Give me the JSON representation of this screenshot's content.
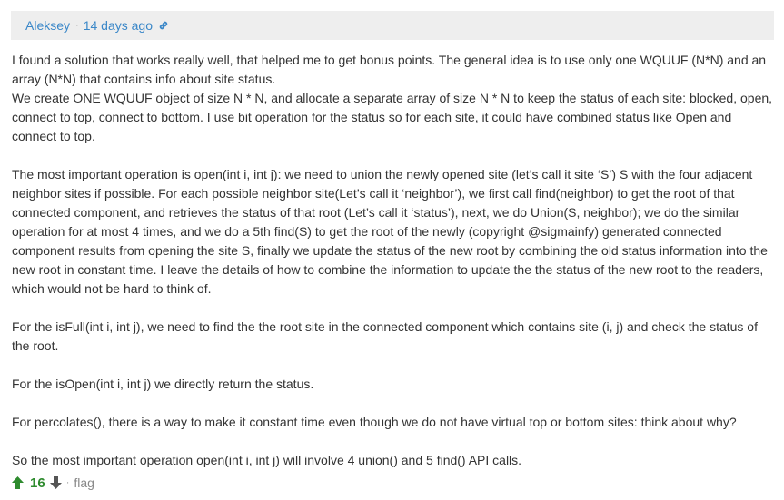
{
  "post": {
    "author": "Aleksey",
    "separator": "·",
    "timestamp": "14 days ago",
    "paragraphs": [
      "I found a solution that works really well, that helped me to get bonus points. The general idea is to use only one WQUUF (N*N) and an array (N*N) that contains info about site status.",
      "We create ONE WQUUF object of size N * N, and allocate a separate array of size N * N to keep the status of each site: blocked, open, connect to top, connect to bottom. I use bit operation for the status so for each site, it could have combined status like Open and connect to top.",
      "The most important operation is open(int i, int j): we need to union the newly opened site (let’s call it site ‘S’) S with the four adjacent neighbor sites if possible. For each possible neighbor site(Let’s call it ‘neighbor’), we first call find(neighbor) to get the root of that connected component, and retrieves the status of that root (Let’s call it ‘status’), next, we do Union(S, neighbor); we do the similar operation for at most 4 times, and we do a 5th find(S) to get the root of the newly (copyright @sigmainfy) generated connected component results from opening the site S, finally we update the status of the new root by combining the old status information into the new root in constant time. I leave the details of how to combine the information to update the the status of the new root to the readers, which would not be hard to think of.",
      "For the isFull(int i, int j), we need to find the the root site in the connected component which contains site (i, j) and check the status of the root.",
      "For the isOpen(int i, int j) we directly return the status.",
      "For percolates(), there is a way to make it constant time even though we do not have virtual top or bottom sites: think about why?",
      "So the most important operation  open(int i, int j) will involve 4 union() and 5 find() API calls."
    ],
    "votes": "16",
    "footer_separator": "·",
    "flag_label": "flag"
  },
  "colors": {
    "link": "#3a87c8",
    "header_bg": "#eeeeee",
    "vote_green": "#2e8b2e",
    "text": "#333333",
    "muted": "#888888"
  },
  "icons": {
    "permalink": "link-icon",
    "upvote": "arrow-up-icon",
    "downvote": "arrow-down-icon"
  }
}
